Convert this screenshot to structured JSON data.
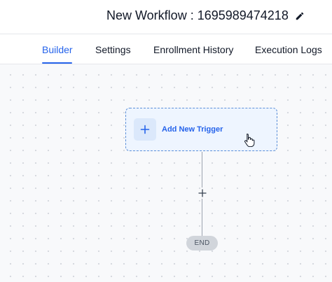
{
  "header": {
    "title": "New Workflow : 1695989474218"
  },
  "tabs": [
    {
      "label": "Builder",
      "active": true
    },
    {
      "label": "Settings",
      "active": false
    },
    {
      "label": "Enrollment History",
      "active": false
    },
    {
      "label": "Execution Logs",
      "active": false
    }
  ],
  "canvas": {
    "trigger": {
      "label": "Add New Trigger",
      "icon": "plus-icon"
    },
    "end_label": "END"
  },
  "colors": {
    "accent": "#2563eb",
    "trigger_bg": "#eef5ff",
    "trigger_border": "#5b8fd8",
    "end_bg": "#d1d5db"
  }
}
